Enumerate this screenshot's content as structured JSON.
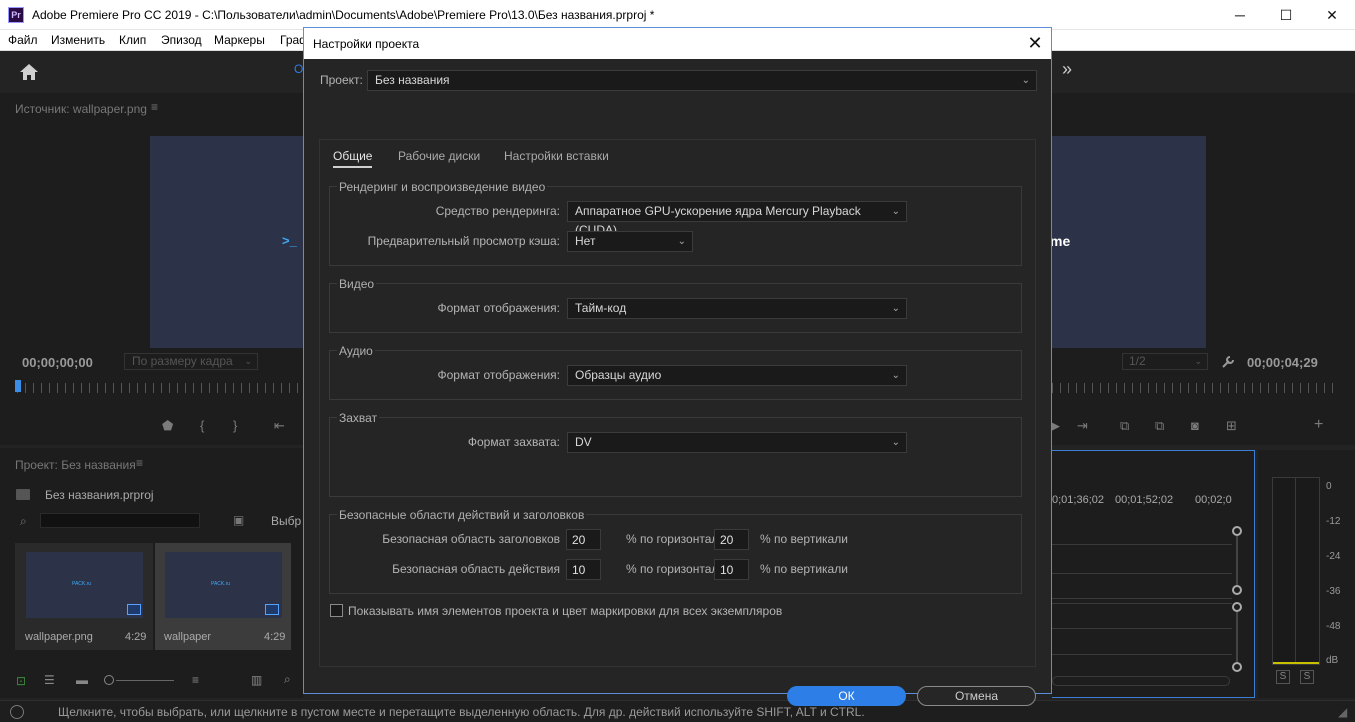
{
  "window": {
    "app_icon_text": "Pr",
    "title": "Adobe Premiere Pro CC 2019 - C:\\Пользователи\\admin\\Documents\\Adobe\\Premiere Pro\\13.0\\Без названия.prproj *",
    "minimize": "─",
    "maximize": "☐",
    "close": "✕"
  },
  "menu": [
    "Файл",
    "Изменить",
    "Клип",
    "Эпизод",
    "Маркеры",
    "Граф"
  ],
  "workspace": {
    "fragment": "О",
    "more": "»"
  },
  "source_monitor": {
    "title": "Источник: wallpaper.png",
    "timecode_in": "00;00;00;00",
    "fit": "По размеру кадра",
    "resolution": "1/2",
    "timecode_out": "00;00;04;29",
    "image_left_text": ">_",
    "image_right_text": "me"
  },
  "project_panel": {
    "title": "Проект: Без названия",
    "file": "Без названия.prproj",
    "selection_fragment": "Выбр",
    "items": [
      {
        "name": "wallpaper.png",
        "duration": "4:29",
        "thumb_text": "PACK.ru"
      },
      {
        "name": "wallpaper",
        "duration": "4:29",
        "thumb_text": "PACK.ru"
      }
    ]
  },
  "timeline": {
    "times": [
      "0;01;36;02",
      "00;01;52;02",
      "00;02;0"
    ]
  },
  "audio_meter": {
    "scale": [
      "0",
      "-12",
      "-24",
      "-36",
      "-48",
      "dB"
    ],
    "solo": [
      "S",
      "S"
    ]
  },
  "statusbar": {
    "text": "Щелкните, чтобы выбрать, или щелкните в пустом месте и перетащите выделенную область. Для др. действий используйте SHIFT, ALT и CTRL."
  },
  "dialog": {
    "title": "Настройки проекта",
    "close": "✕",
    "project_label": "Проект:",
    "project_value": "Без названия",
    "tabs": [
      "Общие",
      "Рабочие диски",
      "Настройки вставки"
    ],
    "active_tab": "Общие",
    "render": {
      "section": "Рендеринг и воспроизведение видео",
      "renderer_label": "Средство рендеринга:",
      "renderer_value": "Аппаратное GPU-ускорение ядра Mercury Playback (CUDA)",
      "cache_label": "Предварительный просмотр кэша:",
      "cache_value": "Нет"
    },
    "video": {
      "section": "Видео",
      "label": "Формат отображения:",
      "value": "Тайм-код"
    },
    "audio": {
      "section": "Аудио",
      "label": "Формат отображения:",
      "value": "Образцы аудио"
    },
    "capture": {
      "section": "Захват",
      "label": "Формат захвата:",
      "value": "DV"
    },
    "safe": {
      "section": "Безопасные области действий и заголовков",
      "title_label": "Безопасная область заголовков",
      "title_h": "20",
      "title_v": "20",
      "action_label": "Безопасная область действия",
      "action_h": "10",
      "action_v": "10",
      "h_suffix": "% по горизонтали",
      "v_suffix": "% по вертикали"
    },
    "checkbox_label": "Показывать имя элементов проекта и цвет маркировки для всех экземпляров",
    "checkbox_checked": false,
    "ok": "ОК",
    "cancel": "Отмена"
  }
}
